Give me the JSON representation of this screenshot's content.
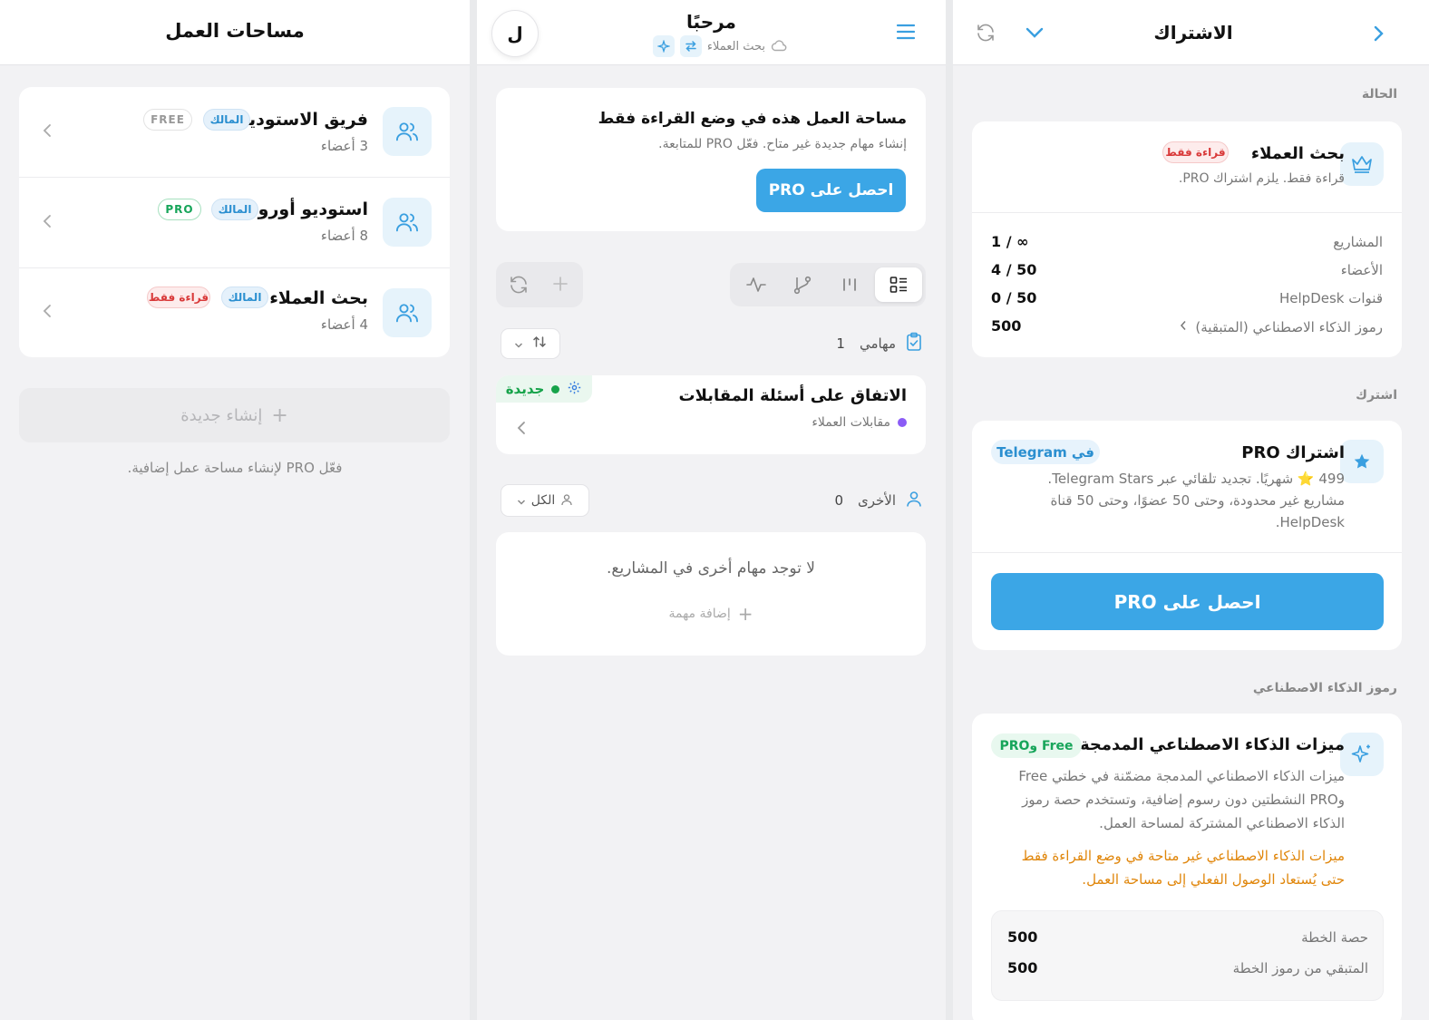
{
  "left": {
    "title": "مساحات العمل",
    "workspaces": [
      {
        "name": "فريق الاستوديو",
        "members": "3 أعضاء",
        "owner_badge": "المالك",
        "plan_badge": "FREE"
      },
      {
        "name": "استوديو أورورا",
        "members": "8 أعضاء",
        "owner_badge": "المالك",
        "plan_badge": "PRO"
      },
      {
        "name": "بحث العملاء",
        "members": "4 أعضاء",
        "owner_badge": "المالك",
        "plan_badge": "قراءة فقط"
      }
    ],
    "create_label": "إنشاء جديدة",
    "pro_hint": "فعّل PRO لإنشاء مساحة عمل إضافية."
  },
  "mid": {
    "greeting": "مرحبًا",
    "workspace_sub": "بحث العملاء",
    "avatar_letter": "ل",
    "banner": {
      "title": "مساحة العمل هذه في وضع القراءة فقط",
      "text": "إنشاء مهام جديدة غير متاح. فعّل PRO للمتابعة.",
      "button": "احصل على PRO"
    },
    "tasks_section": {
      "label": "مهامي",
      "count": "1"
    },
    "task": {
      "title": "الاتفاق على أسئلة المقابلات",
      "project": "مقابلات العملاء",
      "status": "جديدة"
    },
    "other_section": {
      "label": "الأخرى",
      "count": "0",
      "filter": "الكل"
    },
    "empty": {
      "text": "لا توجد مهام أخرى في المشاريع.",
      "add": "إضافة مهمة"
    }
  },
  "right": {
    "title": "الاشتراك",
    "status_label": "الحالة",
    "status": {
      "name": "بحث العملاء",
      "badge": "قراءة فقط",
      "desc": "قراءة فقط. يلزم اشتراك PRO."
    },
    "limits": [
      {
        "label": "المشاريع",
        "value": "1 / ∞"
      },
      {
        "label": "الأعضاء",
        "value": "4 / 50"
      },
      {
        "label": "قنوات HelpDesk",
        "value": "0 / 50"
      },
      {
        "label": "رموز الذكاء الاصطناعي (المتبقية)",
        "value": "500"
      }
    ],
    "subscribe_label": "اشترك",
    "plan": {
      "title": "اشتراك PRO",
      "badge": "في Telegram",
      "line1": "499 ⭐ شهريًا. تجديد تلقائي عبر Telegram Stars.",
      "line2": "مشاريع غير محدودة، وحتى 50 عضوًا، وحتى 50 قناة",
      "line3": "HelpDesk.",
      "button": "احصل على PRO"
    },
    "ai_section_label": "رموز الذكاء الاصطناعي",
    "ai": {
      "title": "ميزات الذكاء الاصطناعي المدمجة",
      "badge": "Free وPRO",
      "desc1": "ميزات الذكاء الاصطناعي المدمجة مضمّنة في خطتي Free",
      "desc2": "وPRO النشطتين دون رسوم إضافية، وتستخدم حصة رموز",
      "desc3": "الذكاء الاصطناعي المشتركة لمساحة العمل.",
      "warn1": "ميزات الذكاء الاصطناعي غير متاحة في وضع القراءة فقط",
      "warn2": "حتى يُستعاد الوصول الفعلي إلى مساحة العمل.",
      "quota": [
        {
          "label": "حصة الخطة",
          "value": "500"
        },
        {
          "label": "المتبقي من رموز الخطة",
          "value": "500"
        }
      ]
    }
  }
}
